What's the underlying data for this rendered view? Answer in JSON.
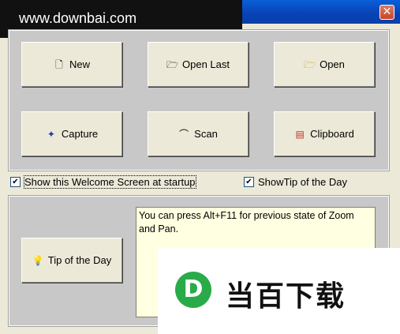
{
  "watermark": {
    "text": "www.downbai.com"
  },
  "titlebar": {
    "close_glyph": "✕"
  },
  "buttons": {
    "new": {
      "label": "New",
      "icon": "new-file-icon"
    },
    "open_last": {
      "label": "Open Last",
      "icon": "folder-open-icon"
    },
    "open": {
      "label": "Open",
      "icon": "folder-icon"
    },
    "capture": {
      "label": "Capture",
      "icon": "magic-wand-icon"
    },
    "scan": {
      "label": "Scan",
      "icon": "scanner-icon"
    },
    "clipboard": {
      "label": "Clipboard",
      "icon": "clipboard-icon"
    },
    "tip": {
      "label": "Tip of the Day",
      "icon": "lightbulb-icon"
    }
  },
  "checkboxes": {
    "welcome": {
      "label": "Show this Welcome Screen at startup",
      "checked": true,
      "mark": "✔"
    },
    "showtip": {
      "label": "ShowTip of the Day",
      "checked": true,
      "mark": "✔"
    }
  },
  "tip_text": "You can press Alt+F11 for previous state of Zoom and Pan.",
  "logo": {
    "letter": "D",
    "text": "当百下载",
    "color": "#2aab49"
  }
}
